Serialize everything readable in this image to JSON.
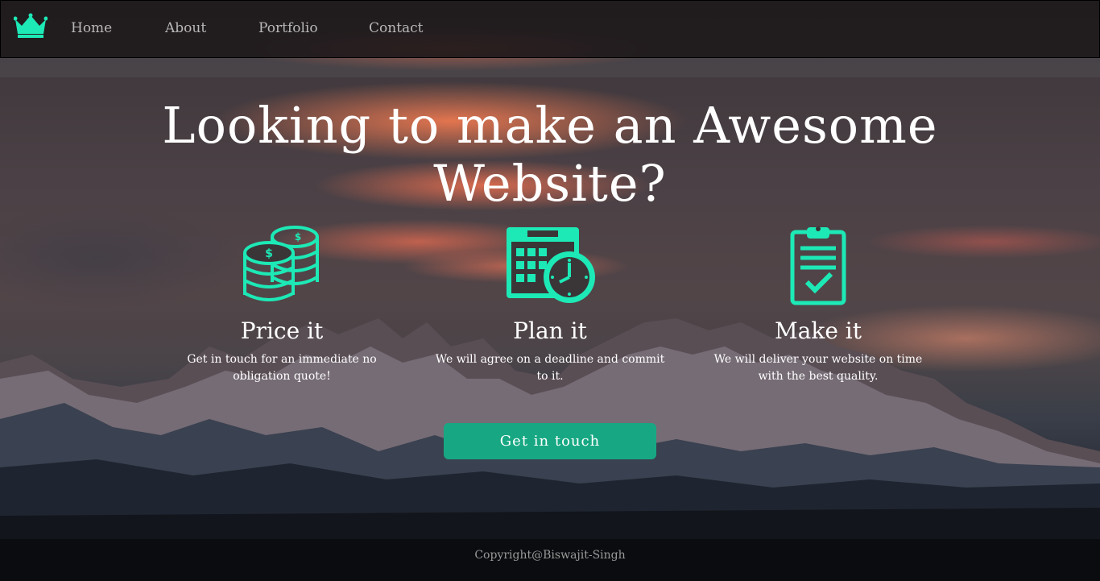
{
  "colors": {
    "accent": "#1de9b6",
    "button_bg": "#17a883",
    "nav_text": "#b8b8b8",
    "footer_text": "#9a9a9a"
  },
  "nav": {
    "logo_icon": "crown-icon",
    "items": [
      {
        "label": "Home"
      },
      {
        "label": "About"
      },
      {
        "label": "Portfolio"
      },
      {
        "label": "Contact"
      }
    ]
  },
  "hero": {
    "title_line1": "Looking to make an Awesome",
    "title_line2": "Website?"
  },
  "features": [
    {
      "icon": "coins-icon",
      "title": "Price it",
      "desc_line1": "Get in touch for an immediate no",
      "desc_line2": "obligation quote!"
    },
    {
      "icon": "calendar-clock-icon",
      "title": "Plan it",
      "desc_line1": "We will agree on a deadline and commit",
      "desc_line2": "to it."
    },
    {
      "icon": "clipboard-check-icon",
      "title": "Make it",
      "desc_line1": "We will deliver your website on time",
      "desc_line2": "with the best quality."
    }
  ],
  "cta": {
    "label": "Get in touch"
  },
  "footer": {
    "text": "Copyright@Biswajit-Singh"
  }
}
